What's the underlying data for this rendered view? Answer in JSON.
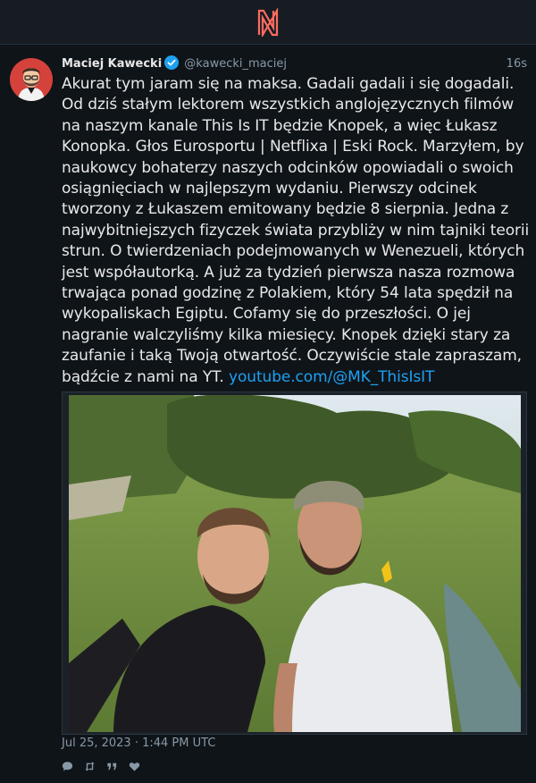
{
  "app": {
    "logo_icon": "nitter-logo-icon",
    "accent": "#ff6c60"
  },
  "tweet": {
    "fullname": "Maciej Kawecki",
    "handle": "@kawecki_maciej",
    "time": "16s",
    "text": "Akurat tym jaram się na maksa. Gadali gadali i się dogadali. Od dziś stałym lektorem wszystkich anglojęzycznych filmów na naszym kanale This Is IT będzie Knopek, a więc Łukasz Konopka. Głos Eurosportu | Netflixa | Eski Rock. Marzyłem, by naukowcy bohaterzy naszych odcinków opowiadali o swoich osiągnięciach w najlepszym wydaniu. Pierwszy odcinek tworzony z Łukaszem emitowany będzie 8 sierpnia. Jedna z najwybitniejszych fizyczek świata przybliży w nim tajniki teorii strun. O twierdzeniach podejmowanych w Wenezueli, których jest współautorką. A już za tydzień pierwsza nasza rozmowa trwająca ponad godzinę z Polakiem, który 54 lata spędził na wykopaliskach Egiptu. Cofamy się do przeszłości. O jej nagranie walczyliśmy kilka miesięcy. Knopek dzięki stary za zaufanie i taką Twoją otwartość. Oczywiście stale zapraszam, bądźcie z nami na YT.",
    "link": "youtube.com/@MK_ThisIsIT",
    "date": "Jul 25, 2023 · 1:44 PM UTC",
    "icons": {
      "verified": "verified-badge-icon",
      "reply": "comment-icon",
      "retweet": "retweet-icon",
      "quote": "quote-icon",
      "like": "heart-icon"
    },
    "colors": {
      "link": "#1da1f2",
      "verified": "#1da1f2",
      "muted": "#8899a6"
    }
  }
}
